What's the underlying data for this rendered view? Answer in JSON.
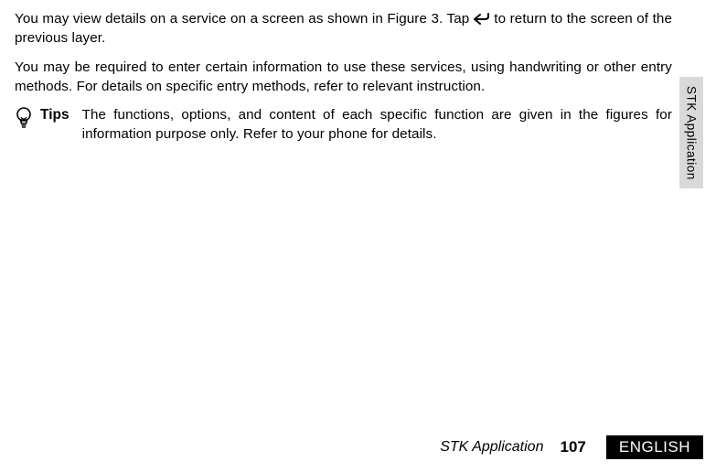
{
  "para1_a": "You may view details on a service on a screen as shown in Figure 3. Tap ",
  "para1_b": " to return to the screen of the previous layer.",
  "para2": "You may be required to enter certain information to use these services, using handwriting or other entry methods. For details on specific entry methods, refer to relevant instruction.",
  "tips_label": "Tips",
  "tips_text": "The functions, options, and content of each specific function are given in the figures for information purpose only. Refer to your phone for details.",
  "side_tab": "STK Application",
  "footer_title": "STK Application",
  "footer_page": "107",
  "footer_lang": "ENGLISH"
}
